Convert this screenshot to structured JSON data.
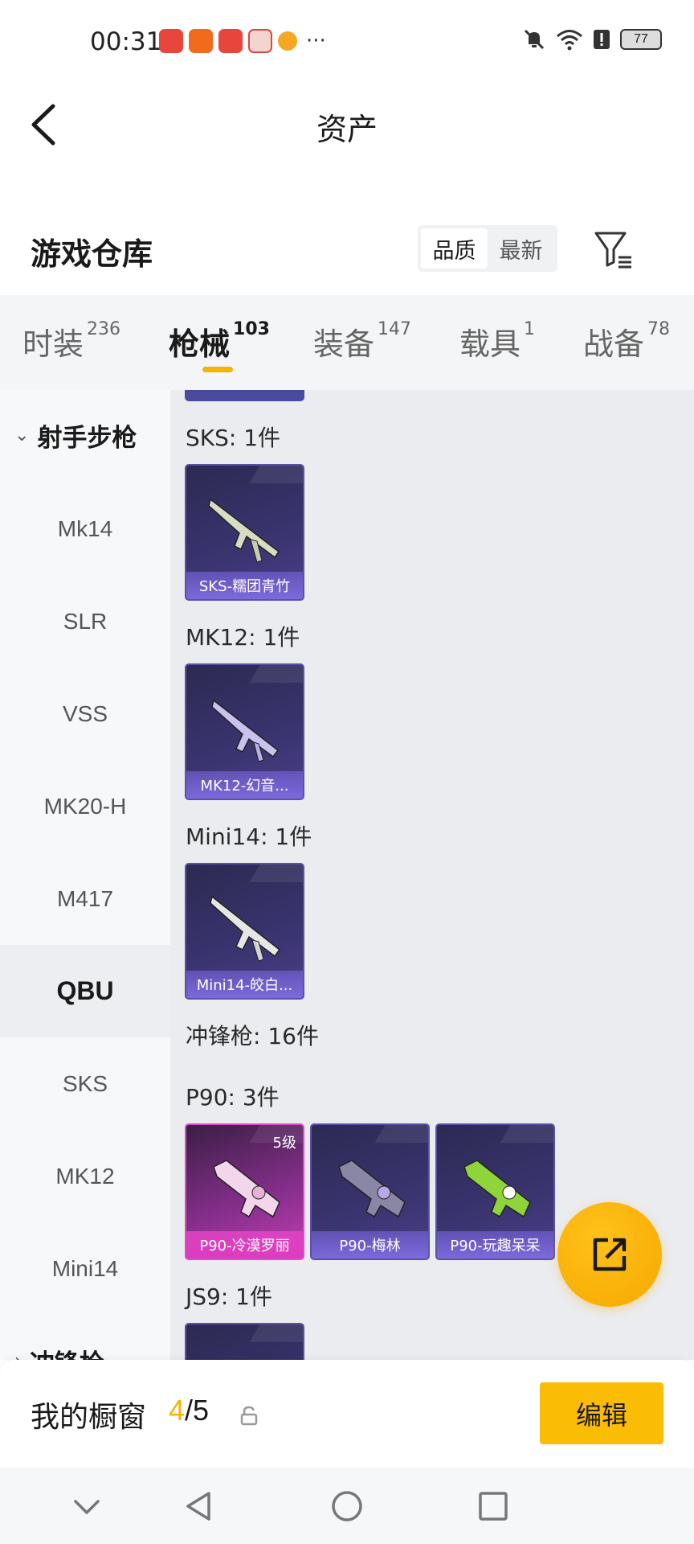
{
  "status_bar": {
    "time": "00:31",
    "more": "···",
    "battery": "77"
  },
  "header": {
    "title": "资产"
  },
  "warehouse": {
    "title": "游戏仓库",
    "sort_options": [
      "品质",
      "最新"
    ],
    "active_sort": "品质"
  },
  "tabs": [
    {
      "label": "时装",
      "count": "236"
    },
    {
      "label": "枪械",
      "count": "103"
    },
    {
      "label": "装备",
      "count": "147"
    },
    {
      "label": "载具",
      "count": "1"
    },
    {
      "label": "战备",
      "count": "78"
    }
  ],
  "active_tab": "枪械",
  "sidebar": {
    "group": "射手步枪",
    "items": [
      "Mk14",
      "SLR",
      "VSS",
      "MK20-H",
      "M417",
      "QBU",
      "SKS",
      "MK12",
      "Mini14"
    ],
    "active": "QBU",
    "next_group": "冲锋枪"
  },
  "content": {
    "sections": [
      {
        "title": "SKS: 1件",
        "cards": [
          {
            "name": "SKS-糯团青竹"
          }
        ]
      },
      {
        "title": "MK12: 1件",
        "cards": [
          {
            "name": "MK12-幻音..."
          }
        ]
      },
      {
        "title": "Mini14: 1件",
        "cards": [
          {
            "name": "Mini14-皎白..."
          }
        ]
      },
      {
        "title": "冲锋枪: 16件",
        "cards": []
      },
      {
        "title": "P90: 3件",
        "cards": [
          {
            "name": "P90-冷漠罗丽",
            "level": "5级",
            "rarity": "pink"
          },
          {
            "name": "P90-梅林"
          },
          {
            "name": "P90-玩趣呆呆"
          }
        ]
      },
      {
        "title": "JS9: 1件",
        "cards": []
      }
    ]
  },
  "showcase": {
    "title": "我的橱窗",
    "current": "4",
    "separator": "/",
    "total": "5",
    "edit_label": "编辑"
  },
  "colors": {
    "accent": "#f5b400",
    "card_blue": "#3a3470",
    "card_pink": "#c43fb2"
  }
}
